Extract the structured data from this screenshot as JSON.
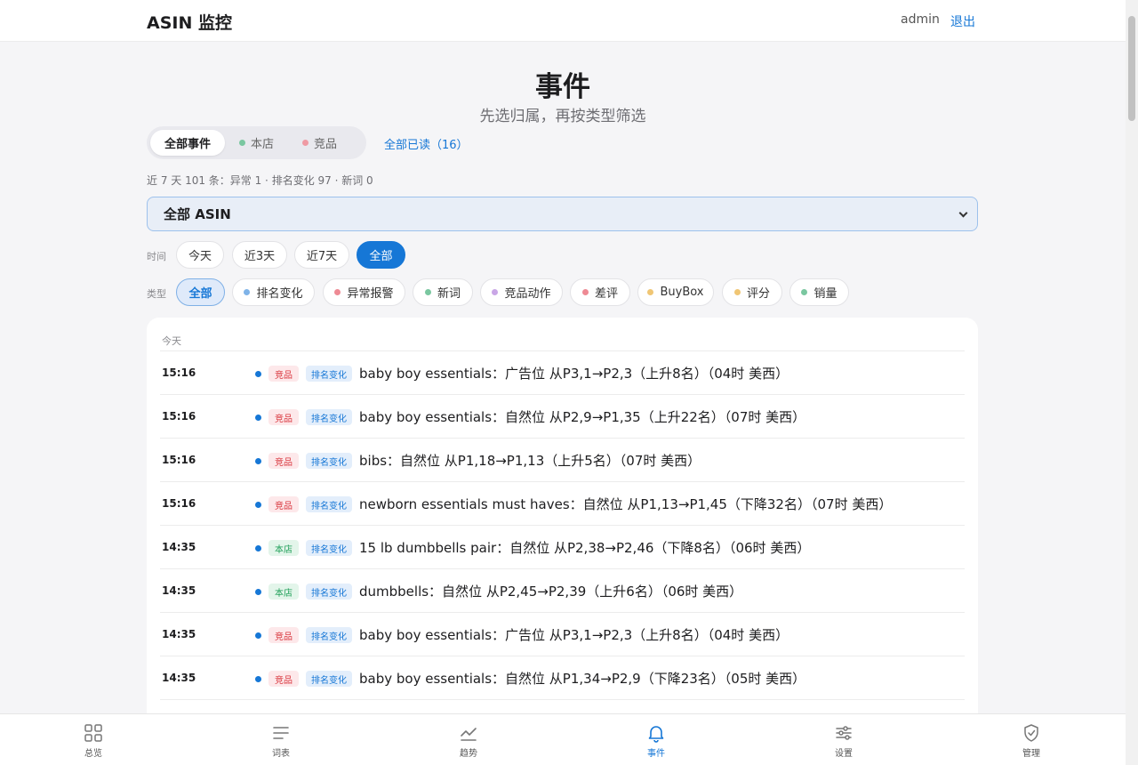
{
  "header": {
    "brand": "ASIN 监控",
    "user": "admin",
    "logout": "退出"
  },
  "page": {
    "title": "事件",
    "subtitle": "先选归属，再按类型筛选"
  },
  "scope_tabs": [
    {
      "label": "全部事件",
      "active": true,
      "dot": ""
    },
    {
      "label": "本店",
      "active": false,
      "dot": "#7ac7a0"
    },
    {
      "label": "竞品",
      "active": false,
      "dot": "#ef9aa3"
    }
  ],
  "mark_all_read": "全部已读（16）",
  "summary": "近 7 天 101 条：异常 1 · 排名变化 97 · 新词 0",
  "asin_select": {
    "value": "全部 ASIN"
  },
  "time_filter": {
    "label": "时间",
    "options": [
      "今天",
      "近3天",
      "近7天",
      "全部"
    ],
    "selected": "全部"
  },
  "type_filter": {
    "label": "类型",
    "options": [
      {
        "label": "全部",
        "dot": ""
      },
      {
        "label": "排名变化",
        "dot": "#7fb3e8"
      },
      {
        "label": "异常报警",
        "dot": "#ee8a94"
      },
      {
        "label": "新词",
        "dot": "#7ac7a0"
      },
      {
        "label": "竞品动作",
        "dot": "#c9a6e6"
      },
      {
        "label": "差评",
        "dot": "#ee8a94"
      },
      {
        "label": "BuyBox",
        "dot": "#f0c674"
      },
      {
        "label": "评分",
        "dot": "#f0c674"
      },
      {
        "label": "销量",
        "dot": "#7ac7a0"
      }
    ],
    "selected": "全部"
  },
  "events": {
    "group_label": "今天",
    "items": [
      {
        "time": "15:16",
        "scope": "竞品",
        "type": "排名变化",
        "text": "baby boy essentials：广告位 从P3,1→P2,3（上升8名）（04时 美西）"
      },
      {
        "time": "15:16",
        "scope": "竞品",
        "type": "排名变化",
        "text": "baby boy essentials：自然位 从P2,9→P1,35（上升22名）（07时 美西）"
      },
      {
        "time": "15:16",
        "scope": "竞品",
        "type": "排名变化",
        "text": "bibs：自然位 从P1,18→P1,13（上升5名）（07时 美西）"
      },
      {
        "time": "15:16",
        "scope": "竞品",
        "type": "排名变化",
        "text": "newborn essentials must haves：自然位 从P1,13→P1,45（下降32名）（07时 美西）"
      },
      {
        "time": "14:35",
        "scope": "本店",
        "type": "排名变化",
        "text": "15 lb dumbbells pair：自然位 从P2,38→P2,46（下降8名）（06时 美西）"
      },
      {
        "time": "14:35",
        "scope": "本店",
        "type": "排名变化",
        "text": "dumbbells：自然位 从P2,45→P2,39（上升6名）（06时 美西）"
      },
      {
        "time": "14:35",
        "scope": "竞品",
        "type": "排名变化",
        "text": "baby boy essentials：广告位 从P3,1→P2,3（上升8名）（04时 美西）"
      },
      {
        "time": "14:35",
        "scope": "竞品",
        "type": "排名变化",
        "text": "baby boy essentials：自然位 从P1,34→P2,9（下降23名）（05时 美西）"
      }
    ]
  },
  "bottom_nav": [
    {
      "label": "总览",
      "icon": "grid-icon",
      "active": false
    },
    {
      "label": "词表",
      "icon": "list-icon",
      "active": false
    },
    {
      "label": "趋势",
      "icon": "trend-icon",
      "active": false
    },
    {
      "label": "事件",
      "icon": "bell-icon",
      "active": true
    },
    {
      "label": "设置",
      "icon": "sliders-icon",
      "active": false
    },
    {
      "label": "管理",
      "icon": "shield-icon",
      "active": false
    }
  ],
  "colors": {
    "accent": "#1677d6",
    "competitor": "#d9363e",
    "own_store": "#21a05a"
  }
}
